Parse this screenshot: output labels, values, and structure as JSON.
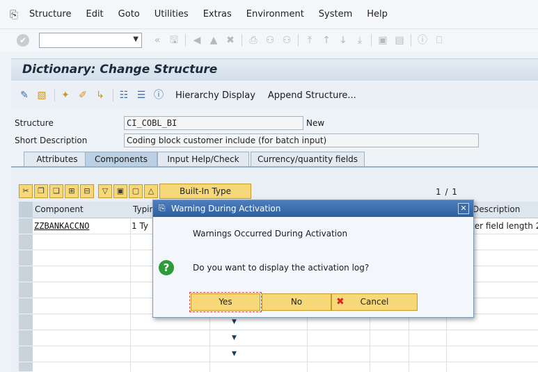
{
  "menubar": {
    "items": [
      "Structure",
      "Edit",
      "Goto",
      "Utilities",
      "Extras",
      "Environment",
      "System",
      "Help"
    ]
  },
  "header": {
    "title": "Dictionary: Change Structure"
  },
  "app_toolbar": {
    "hierarchy_display": "Hierarchy Display",
    "append_structure": "Append Structure..."
  },
  "fields": {
    "structure_label": "Structure",
    "structure_value": "CI_COBL_BI",
    "structure_status": "New",
    "short_desc_label": "Short Description",
    "short_desc_value": "Coding block customer include (for batch input)"
  },
  "tabs": [
    "Attributes",
    "Components",
    "Input Help/Check",
    "Currency/quantity fields"
  ],
  "table_toolbar": {
    "builtin_type": "Built-In Type",
    "page_indicator": "1 / 1"
  },
  "table": {
    "headers": {
      "component": "Component",
      "typing": "Typin",
      "description": "Description"
    },
    "rows": [
      {
        "component": "ZZBANKACCNO",
        "typing": "1 Ty",
        "description": "ter field length 2"
      }
    ]
  },
  "dialog": {
    "title": "Warning During Activation",
    "message": "Warnings Occurred During Activation",
    "question": "Do you want to display the activation log?",
    "yes": "Yes",
    "no": "No",
    "cancel": "Cancel"
  },
  "colors": {
    "dialog_title": "#3a6aa8",
    "button": "#f6d879",
    "question_icon": "#2e9a3a",
    "cancel_icon": "#d2281e"
  }
}
